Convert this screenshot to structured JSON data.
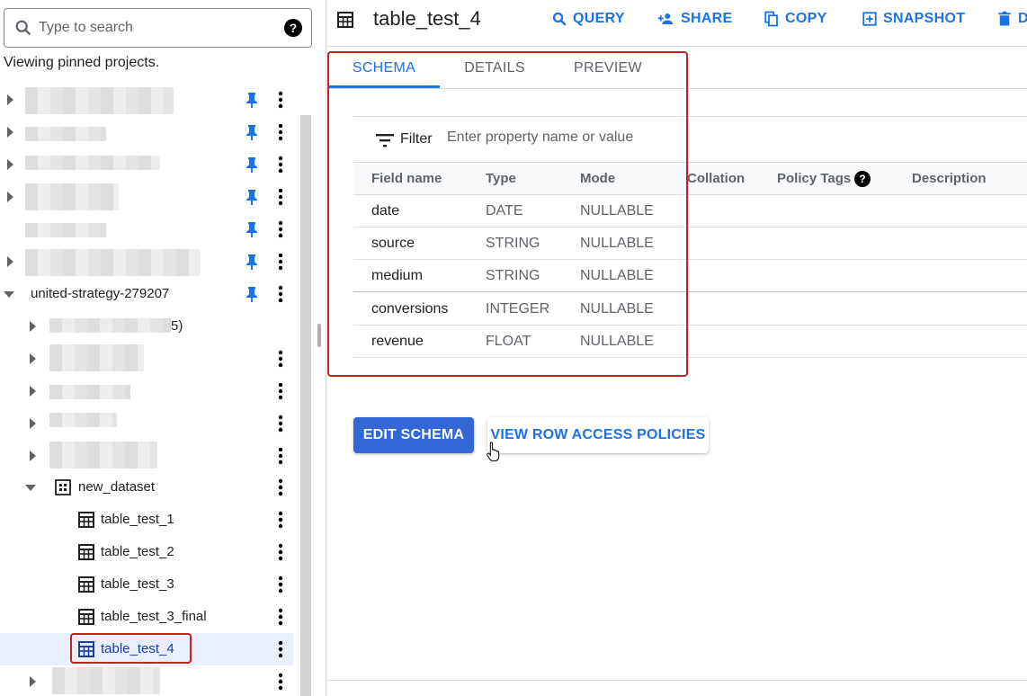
{
  "search": {
    "placeholder": "Type to search",
    "help": "?"
  },
  "explorer": {
    "note": "Viewing pinned projects.",
    "project": "united-strategy-279207",
    "partial_suffix": "5)",
    "dataset": "new_dataset",
    "tables": [
      "table_test_1",
      "table_test_2",
      "table_test_3",
      "table_test_3_final",
      "table_test_4"
    ]
  },
  "header": {
    "title": "table_test_4",
    "actions": [
      "QUERY",
      "SHARE",
      "COPY",
      "SNAPSHOT",
      "D"
    ]
  },
  "tabs": [
    "SCHEMA",
    "DETAILS",
    "PREVIEW"
  ],
  "filter": {
    "label": "Filter",
    "placeholder": "Enter property name or value"
  },
  "schema": {
    "columns": [
      "Field name",
      "Type",
      "Mode",
      "Collation",
      "Policy Tags",
      "Description"
    ],
    "policy_help": "?",
    "rows": [
      [
        "date",
        "DATE",
        "NULLABLE"
      ],
      [
        "source",
        "STRING",
        "NULLABLE"
      ],
      [
        "medium",
        "STRING",
        "NULLABLE"
      ],
      [
        "conversions",
        "INTEGER",
        "NULLABLE"
      ],
      [
        "revenue",
        "FLOAT",
        "NULLABLE"
      ]
    ]
  },
  "buttons": {
    "edit_schema": "EDIT SCHEMA",
    "row_access": "VIEW ROW ACCESS POLICIES"
  },
  "colors": {
    "accent": "#1a73e8",
    "primary_button": "#3367d6",
    "highlight": "#c5221f",
    "selected_row": "#e8f0fe"
  }
}
